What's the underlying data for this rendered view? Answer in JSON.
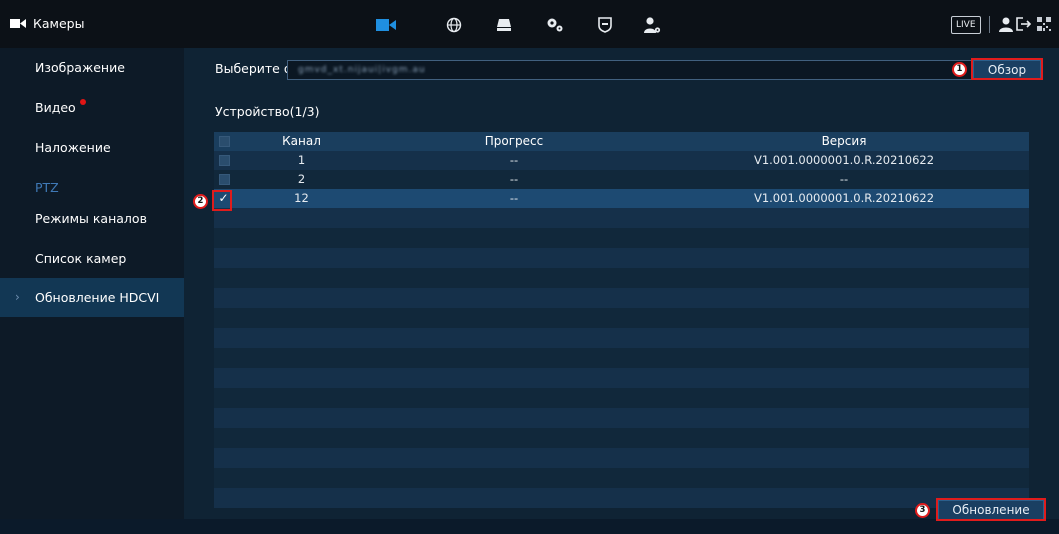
{
  "header": {
    "title": "Камеры",
    "live_label": "LIVE",
    "nav_icons": [
      "camera-icon",
      "network-globe-icon",
      "storage-icon",
      "settings-gears-icon",
      "shield-icon",
      "user-settings-icon"
    ]
  },
  "sidebar": {
    "items": [
      {
        "label": "Изображение",
        "state": "normal"
      },
      {
        "label": "Видео",
        "state": "badge"
      },
      {
        "label": "Наложение",
        "state": "normal"
      },
      {
        "label": "PTZ",
        "state": "disabled"
      },
      {
        "label": "Режимы каналов",
        "state": "normal"
      },
      {
        "label": "Список камер",
        "state": "normal"
      },
      {
        "label": "Обновление HDCVI",
        "state": "active"
      }
    ]
  },
  "main": {
    "file_label": "Выберите о...",
    "file_value": "gmvd_xt.nijaui|ivgm.au",
    "browse_label": "Обзор",
    "device_label": "Устройство(1/3)",
    "update_label": "Обновление",
    "annotations": [
      "1",
      "2",
      "3"
    ],
    "table": {
      "columns": [
        "Канал",
        "Прогресс",
        "Версия"
      ],
      "rows": [
        {
          "checked": false,
          "channel": "1",
          "progress": "--",
          "version": "V1.001.0000001.0.R.20210622"
        },
        {
          "checked": false,
          "channel": "2",
          "progress": "--",
          "version": "--"
        },
        {
          "checked": true,
          "channel": "12",
          "progress": "--",
          "version": "V1.001.0000001.0.R.20210622"
        }
      ]
    }
  },
  "colors": {
    "accent": "#1a3f62",
    "annotation": "#e01c1c",
    "active_item": "#123754",
    "badge": "#e01515"
  }
}
